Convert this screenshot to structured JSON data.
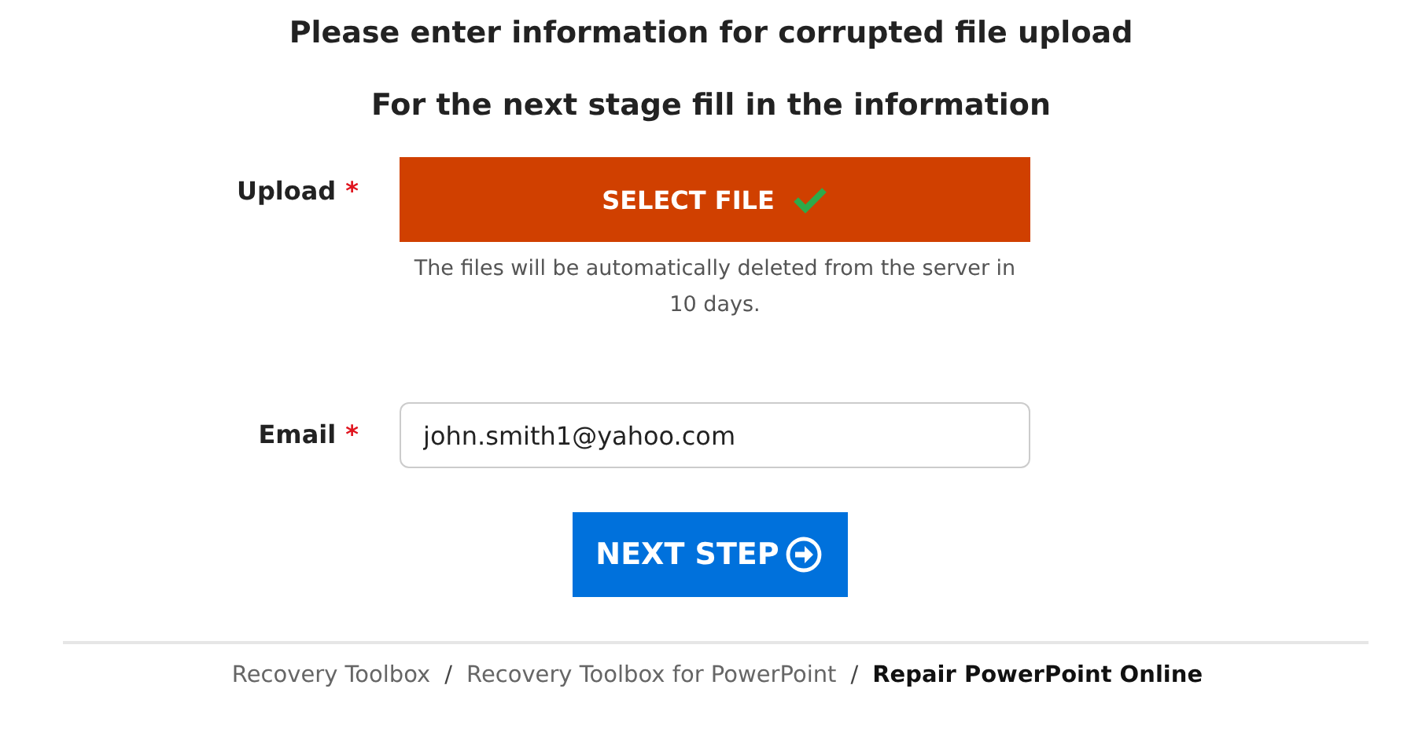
{
  "headings": [
    "Please enter information for corrupted file upload",
    "For the next stage fill in the information"
  ],
  "upload": {
    "label": "Upload",
    "required_mark": "*",
    "button": "SELECT FILE",
    "file_selected": true,
    "help": "The files will be automatically deleted from the server in 10 days."
  },
  "email": {
    "label": "Email",
    "required_mark": "*",
    "value": "john.smith1@yahoo.com"
  },
  "next_button": "NEXT STEP",
  "breadcrumb": [
    {
      "kind": "link",
      "text": "Recovery Toolbox"
    },
    {
      "kind": "separator",
      "text": "/"
    },
    {
      "kind": "link",
      "text": "Recovery Toolbox for PowerPoint"
    },
    {
      "kind": "separator",
      "text": "/"
    },
    {
      "kind": "current",
      "text": "Repair PowerPoint Online"
    }
  ]
}
